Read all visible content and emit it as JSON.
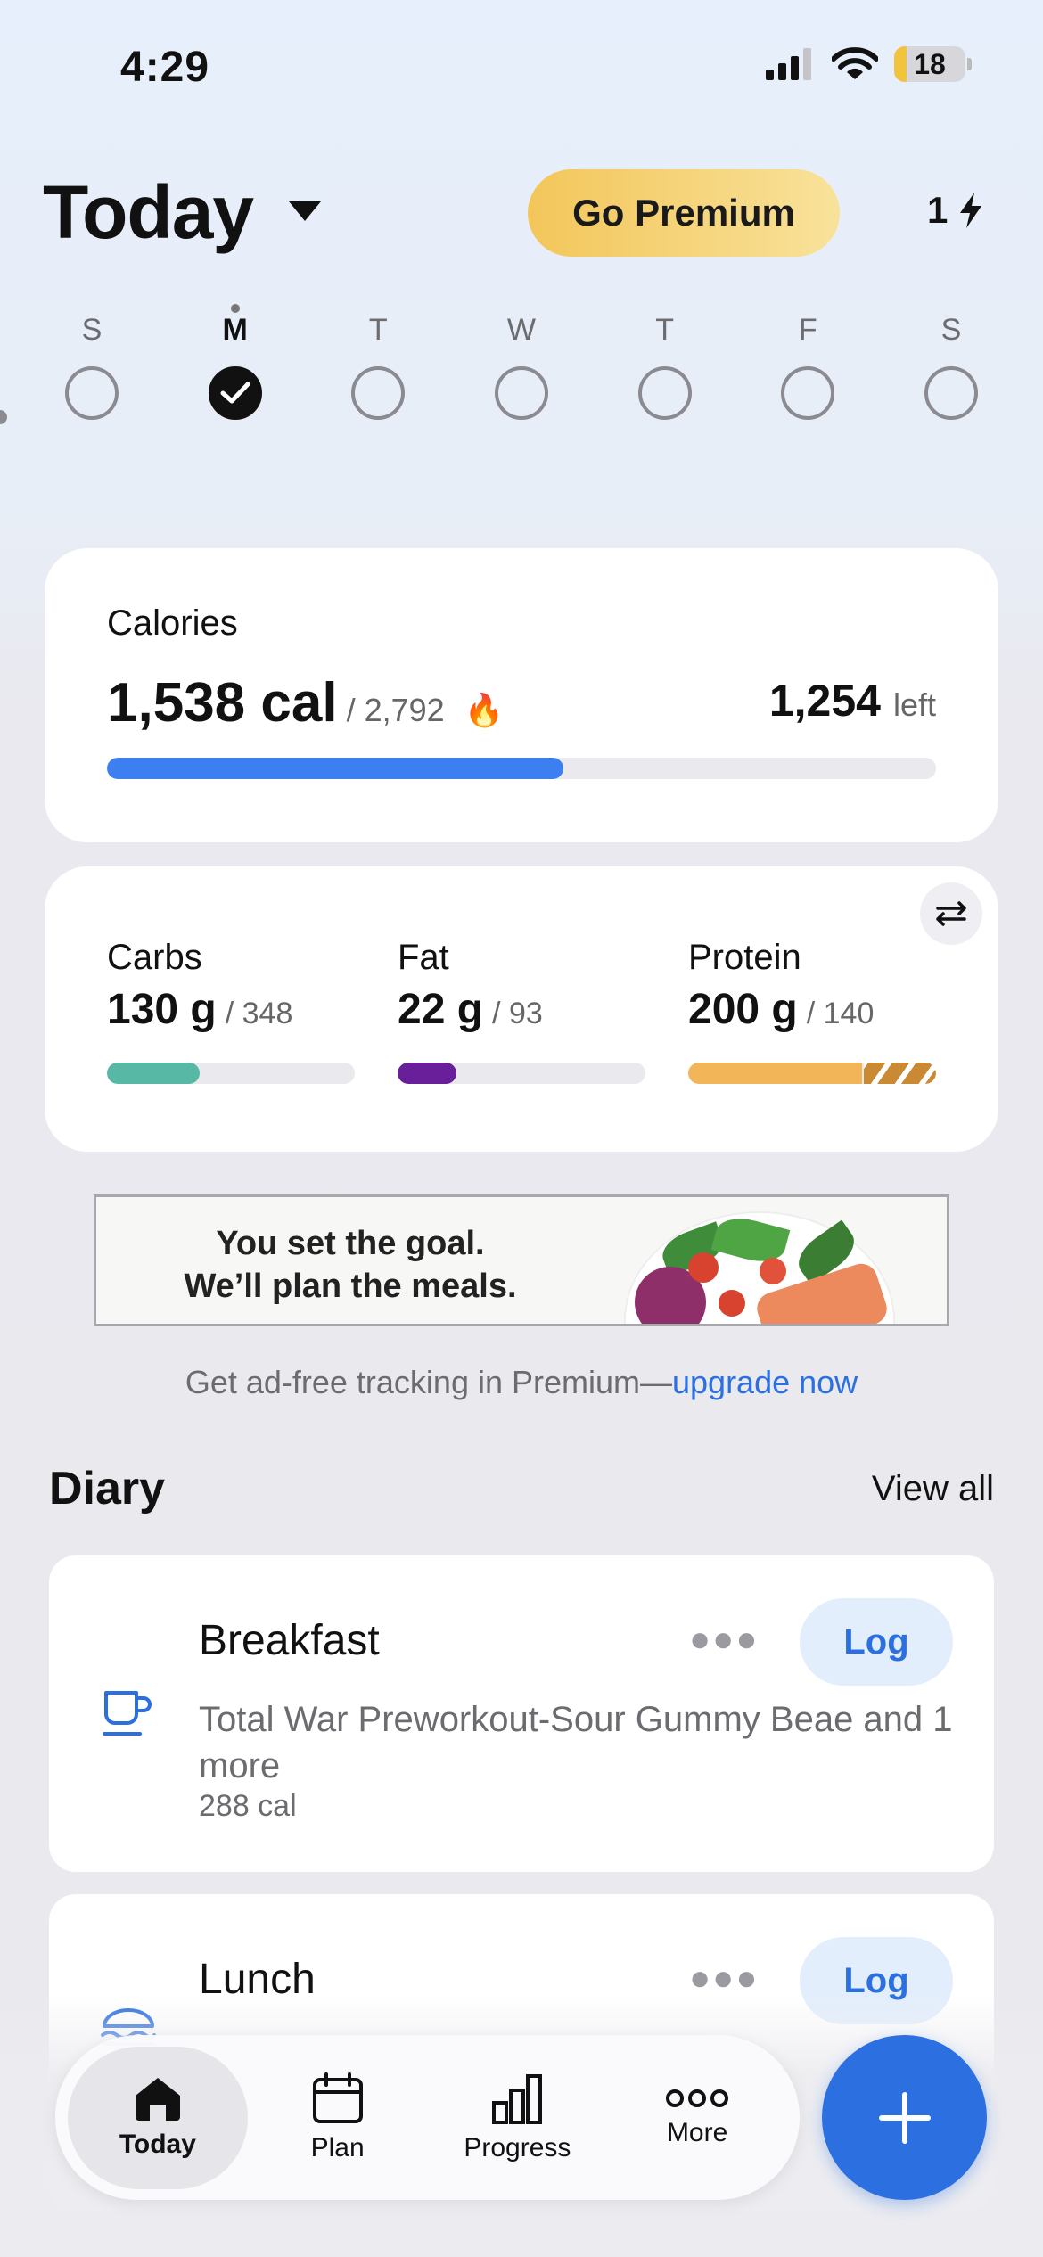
{
  "status_bar": {
    "time": "4:29",
    "battery": "18"
  },
  "header": {
    "title": "Today",
    "premium_label": "Go Premium",
    "streak_count": "1"
  },
  "week": {
    "days": [
      {
        "letter": "S",
        "checked": false
      },
      {
        "letter": "M",
        "checked": true
      },
      {
        "letter": "T",
        "checked": false
      },
      {
        "letter": "W",
        "checked": false
      },
      {
        "letter": "T",
        "checked": false
      },
      {
        "letter": "F",
        "checked": false
      },
      {
        "letter": "S",
        "checked": false
      }
    ]
  },
  "calories": {
    "label": "Calories",
    "consumed": "1,538 cal",
    "goal": "/ 2,792",
    "flame": "🔥",
    "left_value": "1,254",
    "left_label": "left",
    "progress": 0.551,
    "color": "#3d7ff0"
  },
  "macros": [
    {
      "label": "Carbs",
      "value": "130 g",
      "goal": "/ 348",
      "progress": 0.374,
      "color": "#57b8a6"
    },
    {
      "label": "Fat",
      "value": "22 g",
      "goal": "/ 93",
      "progress": 0.237,
      "color": "#6a1f9a"
    },
    {
      "label": "Protein",
      "value": "200 g",
      "goal": "/ 140",
      "progress": 1.0,
      "over_start": 0.7,
      "color": "#f2b658"
    }
  ],
  "ad": {
    "line1": "You set the goal.",
    "line2": "We’ll plan the meals.",
    "note": "Get ad-free tracking in Premium—",
    "note_link": "upgrade now"
  },
  "diary": {
    "title": "Diary",
    "view_all": "View all",
    "meals": [
      {
        "name": "Breakfast",
        "icon": "coffee-cup-icon",
        "description": "Total War Preworkout-Sour Gummy Beae and 1 more",
        "calories": "288 cal",
        "log_label": "Log"
      },
      {
        "name": "Lunch",
        "icon": "burger-icon",
        "log_label": "Log"
      }
    ]
  },
  "nav": {
    "tabs": [
      {
        "label": "Today",
        "icon": "home-icon",
        "active": true
      },
      {
        "label": "Plan",
        "icon": "calendar-icon",
        "active": false
      },
      {
        "label": "Progress",
        "icon": "bar-chart-icon",
        "active": false
      },
      {
        "label": "More",
        "icon": "more-icon",
        "active": false
      }
    ],
    "fab_icon": "plus-icon"
  },
  "colors": {
    "accent": "#2b6fe0",
    "premium_start": "#f3c65a",
    "premium_end": "#f8e29b"
  }
}
